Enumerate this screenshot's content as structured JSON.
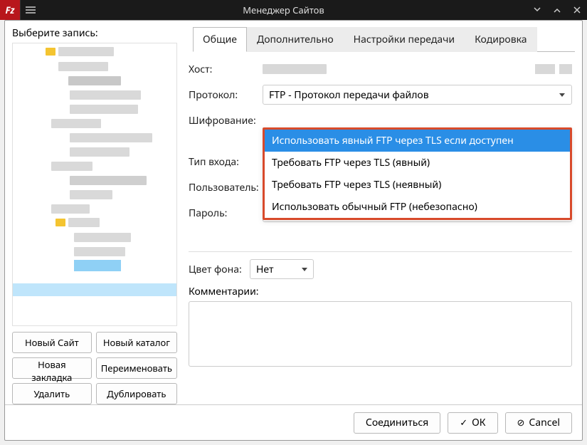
{
  "titlebar": {
    "title": "Менеджер Сайтов"
  },
  "left": {
    "label": "Выберите запись:",
    "buttons": {
      "new_site": "Новый Сайт",
      "new_folder": "Новый каталог",
      "new_bookmark": "Новая закладка",
      "rename": "Переименовать",
      "delete": "Удалить",
      "duplicate": "Дублировать"
    }
  },
  "tabs": {
    "general": "Общие",
    "advanced": "Дополнительно",
    "transfer": "Настройки передачи",
    "encoding": "Кодировка"
  },
  "form": {
    "host_label": "Хост:",
    "protocol_label": "Протокол:",
    "protocol_value": "FTP - Протокол передачи файлов",
    "encryption_label": "Шифрование:",
    "encryption_options": [
      "Использовать явный FTP через TLS если доступен",
      "Требовать FTP через TLS (явный)",
      "Требовать FTP через TLS (неявный)",
      "Использовать обычный FTP (небезопасно)"
    ],
    "logon_label": "Тип входа:",
    "user_label": "Пользователь:",
    "password_label": "Пароль:",
    "password_value": "••••••••",
    "bgcolor_label": "Цвет фона:",
    "bgcolor_value": "Нет",
    "comments_label": "Комментарии:"
  },
  "footer": {
    "connect": "Соединиться",
    "ok": "ОК",
    "cancel": "Cancel"
  }
}
